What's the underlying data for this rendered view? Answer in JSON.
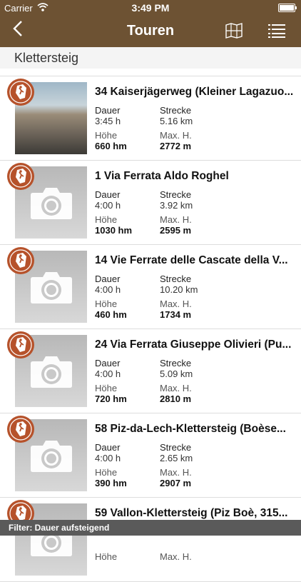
{
  "status_bar": {
    "carrier": "Carrier",
    "time": "3:49 PM"
  },
  "nav": {
    "title": "Touren",
    "back_icon": "back-chevron-icon",
    "map_icon": "map-icon",
    "list_icon": "list-icon"
  },
  "section": {
    "title": "Klettersteig"
  },
  "labels": {
    "duration": "Dauer",
    "distance": "Strecke",
    "height": "Höhe",
    "max_height": "Max. H."
  },
  "tours": [
    {
      "name": "34 Kaiserjägerweg (Kleiner Lagazuo...",
      "duration": "3:45 h",
      "distance": "5.16 km",
      "height": "660 hm",
      "max_height": "2772 m",
      "image": "photo"
    },
    {
      "name": "1 Via Ferrata Aldo Roghel",
      "duration": "4:00 h",
      "distance": "3.92 km",
      "height": "1030 hm",
      "max_height": "2595 m",
      "image": "placeholder"
    },
    {
      "name": "14 Vie Ferrate delle Cascate della V...",
      "duration": "4:00 h",
      "distance": "10.20 km",
      "height": "460 hm",
      "max_height": "1734 m",
      "image": "placeholder"
    },
    {
      "name": "24 Via Ferrata Giuseppe Olivieri (Pu...",
      "duration": "4:00 h",
      "distance": "5.09 km",
      "height": "720 hm",
      "max_height": "2810 m",
      "image": "placeholder"
    },
    {
      "name": "58 Piz-da-Lech-Klettersteig (Boèse...",
      "duration": "4:00 h",
      "distance": "2.65 km",
      "height": "390 hm",
      "max_height": "2907 m",
      "image": "placeholder"
    },
    {
      "name": "59 Vallon-Klettersteig (Piz Boè, 315...",
      "duration": "",
      "distance": "",
      "height": "",
      "max_height": "",
      "image": "placeholder"
    }
  ],
  "filter_bar": {
    "text": "Filter: Dauer aufsteigend"
  },
  "colors": {
    "header": "#6d5233",
    "badge": "#b6522b",
    "filter_bar": "#5a5a5a"
  }
}
